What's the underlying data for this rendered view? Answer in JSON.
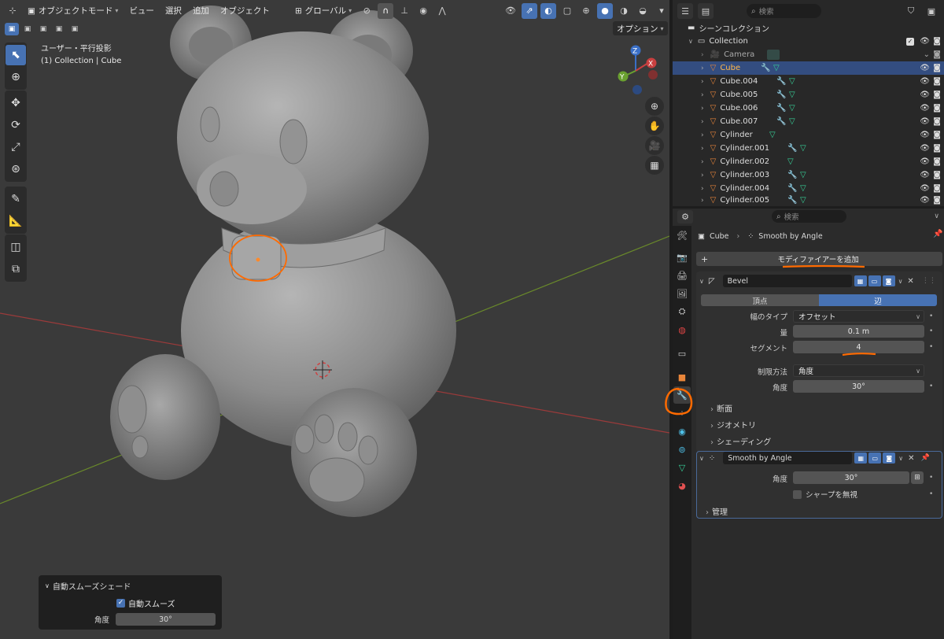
{
  "viewport": {
    "header": {
      "mode": "オブジェクトモード",
      "menus": [
        "ビュー",
        "選択",
        "追加",
        "オブジェクト"
      ],
      "transform_orientation": "グローバル",
      "options_label": "オプション"
    },
    "overlay_text": {
      "view_name": "ユーザー・平行投影",
      "collection_info": "(1) Collection | Cube"
    },
    "gizmo_axes": [
      "X",
      "Y",
      "Z"
    ],
    "redo_panel": {
      "title": "自動スムーズシェード",
      "checkbox_label": "自動スムーズ",
      "angle_label": "角度",
      "angle_value": "30°"
    }
  },
  "outliner": {
    "search_placeholder": "検索",
    "scene_collection": "シーンコレクション",
    "collection": "Collection",
    "items": [
      {
        "name": "Camera",
        "type": "camera"
      },
      {
        "name": "Cube",
        "type": "mesh",
        "selected": true
      },
      {
        "name": "Cube.004",
        "type": "mesh"
      },
      {
        "name": "Cube.005",
        "type": "mesh"
      },
      {
        "name": "Cube.006",
        "type": "mesh"
      },
      {
        "name": "Cube.007",
        "type": "mesh"
      },
      {
        "name": "Cylinder",
        "type": "mesh"
      },
      {
        "name": "Cylinder.001",
        "type": "mesh"
      },
      {
        "name": "Cylinder.002",
        "type": "mesh"
      },
      {
        "name": "Cylinder.003",
        "type": "mesh"
      },
      {
        "name": "Cylinder.004",
        "type": "mesh"
      },
      {
        "name": "Cylinder.005",
        "type": "mesh"
      }
    ]
  },
  "properties": {
    "search_placeholder": "検索",
    "breadcrumb": {
      "object": "Cube",
      "modifier": "Smooth by Angle"
    },
    "add_modifier_label": "モディファイアーを追加",
    "bevel": {
      "name": "Bevel",
      "tab_vertex": "頂点",
      "tab_edge": "辺",
      "width_type_label": "幅のタイプ",
      "width_type_value": "オフセット",
      "amount_label": "量",
      "amount_value": "0.1 m",
      "segments_label": "セグメント",
      "segments_value": "4",
      "limit_method_label": "制限方法",
      "limit_method_value": "角度",
      "angle_label": "角度",
      "angle_value": "30°",
      "sections": [
        "断面",
        "ジオメトリ",
        "シェーディング"
      ]
    },
    "smooth": {
      "name": "Smooth by Angle",
      "angle_label": "角度",
      "angle_value": "30°",
      "ignore_sharp_label": "シャープを無視",
      "manage_label": "管理"
    }
  },
  "colors": {
    "accent": "#4772b3",
    "annotation": "#ff6a00",
    "mesh_icon": "#e8853a",
    "modifier_icon": "#4fc1e9",
    "vertex_group_icon": "#37d39a"
  }
}
